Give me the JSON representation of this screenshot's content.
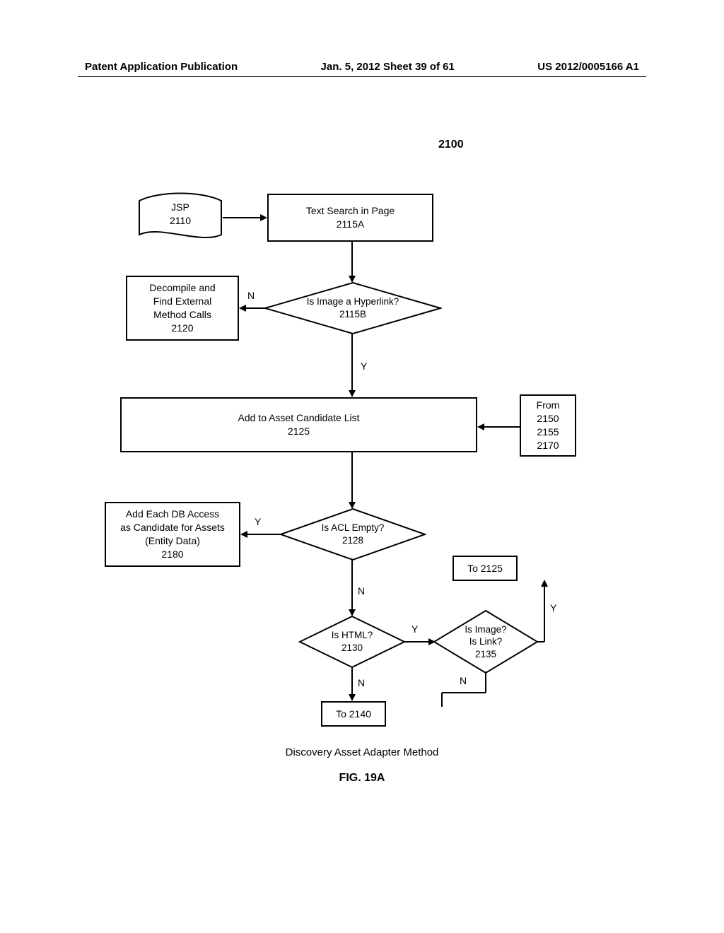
{
  "header": {
    "left": "Patent Application Publication",
    "center": "Jan. 5, 2012  Sheet 39 of 61",
    "right": "US 2012/0005166 A1"
  },
  "ref": {
    "figure_ref": "2100"
  },
  "nodes": {
    "jsp": {
      "line1": "JSP",
      "line2": "2110"
    },
    "text_search": {
      "line1": "Text Search in Page",
      "line2": "2115A"
    },
    "decompile": {
      "line1": "Decompile and",
      "line2": "Find External",
      "line3": "Method Calls",
      "line4": "2120"
    },
    "d_hyperlink": {
      "line1": "Is Image a Hyperlink?",
      "line2": "2115B"
    },
    "add_acl": {
      "line1": "Add to Asset Candidate List",
      "line2": "2125"
    },
    "from_box": {
      "line1": "From",
      "line2": "2150",
      "line3": "2155",
      "line4": "2170"
    },
    "add_db": {
      "line1": "Add Each DB Access",
      "line2": "as Candidate for Assets",
      "line3": "(Entity Data)",
      "line4": "2180"
    },
    "d_acl": {
      "line1": "Is ACL Empty?",
      "line2": "2128"
    },
    "to_2125": {
      "text": "To 2125"
    },
    "d_html": {
      "line1": "Is HTML?",
      "line2": "2130"
    },
    "d_img_link": {
      "line1": "Is Image?",
      "line2": "Is Link?",
      "line3": "2135"
    },
    "to_2140": {
      "text": "To 2140"
    }
  },
  "labels": {
    "Y": "Y",
    "N": "N"
  },
  "caption": "Discovery Asset Adapter Method",
  "figure": "FIG. 19A"
}
